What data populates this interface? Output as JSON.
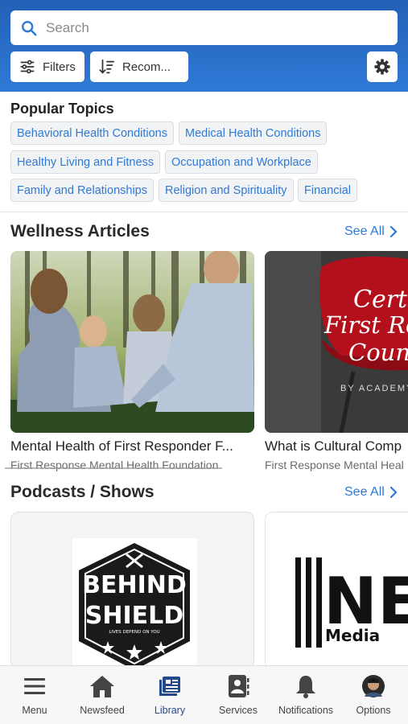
{
  "search": {
    "placeholder": "Search"
  },
  "toolbar": {
    "filters_label": "Filters",
    "sort_label": "Recom..."
  },
  "popular_topics": {
    "title": "Popular Topics",
    "tags": [
      "Behavioral Health Conditions",
      "Medical Health Conditions",
      "Healthy Living and Fitness",
      "Occupation and Workplace",
      "Family and Relationships",
      "Religion and Spirituality",
      "Financial"
    ]
  },
  "wellness": {
    "title": "Wellness Articles",
    "see_all": "See All",
    "articles": [
      {
        "title": "Mental Health of First Responder F...",
        "source": "First Response Mental Health Foundation"
      },
      {
        "title": "What is Cultural Comp",
        "source": "First Response Mental Heal",
        "image_text": [
          "Certif",
          "First Resp",
          "Counse",
          "BY ACADEMY"
        ]
      }
    ]
  },
  "podcasts": {
    "title": "Podcasts / Shows",
    "see_all": "See All",
    "shows": [
      {
        "logo_text": [
          "BEHIND",
          "SHIELD"
        ],
        "logo_small": "LIVES DEPEND ON YOU"
      },
      {
        "logo_text": [
          "NE",
          "Media"
        ]
      }
    ]
  },
  "tabs": [
    {
      "label": "Menu",
      "icon": "menu-icon"
    },
    {
      "label": "Newsfeed",
      "icon": "home-icon"
    },
    {
      "label": "Library",
      "icon": "library-icon",
      "active": true
    },
    {
      "label": "Services",
      "icon": "contacts-icon"
    },
    {
      "label": "Notifications",
      "icon": "bell-icon"
    },
    {
      "label": "Options",
      "icon": "avatar"
    }
  ],
  "colors": {
    "header": "#2f7ad6",
    "accent": "#2f7ad6",
    "active_tab": "#24498a"
  }
}
